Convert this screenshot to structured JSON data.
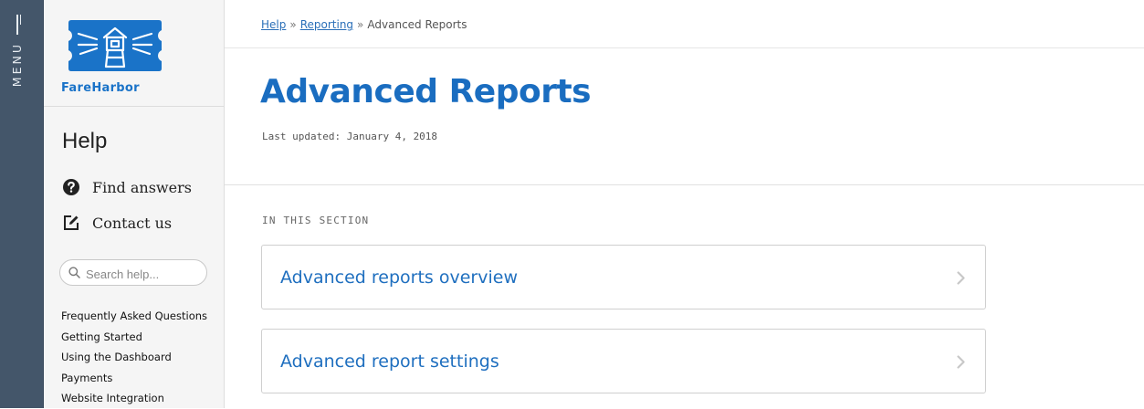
{
  "menu": {
    "label": "MENU"
  },
  "brand": {
    "name": "FareHarbor"
  },
  "sidebar": {
    "title": "Help",
    "links": [
      {
        "label": "Find answers",
        "icon": "question-circle-icon"
      },
      {
        "label": "Contact us",
        "icon": "edit-icon"
      }
    ],
    "search": {
      "placeholder": "Search help...",
      "value": ""
    },
    "categories": [
      "Frequently Asked Questions",
      "Getting Started",
      "Using the Dashboard",
      "Payments",
      "Website Integration"
    ]
  },
  "breadcrumb": {
    "items": [
      "Help",
      "Reporting",
      "Advanced Reports"
    ],
    "separator": "»"
  },
  "page": {
    "title": "Advanced Reports",
    "updated": "Last updated: January 4, 2018",
    "section_label": "IN THIS SECTION",
    "cards": [
      {
        "label": "Advanced reports overview"
      },
      {
        "label": "Advanced report settings"
      }
    ]
  },
  "colors": {
    "menu_bg": "#44566a",
    "brand_blue": "#1a73c8",
    "link_blue": "#2a6fb8",
    "title_blue": "#1a6dc0"
  }
}
